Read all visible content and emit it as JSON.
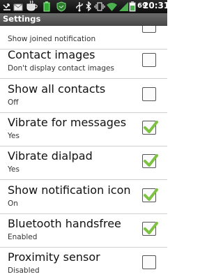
{
  "status_bar": {
    "battery_level": "69",
    "time": "20:31",
    "icons": [
      "missed-call-icon",
      "mail-icon",
      "coffee-cup-icon",
      "battery-app-icon",
      "shield-icon",
      "usb-icon",
      "bluetooth-icon",
      "vibrate-icon",
      "wifi-icon",
      "signal-icon",
      "battery-icon"
    ]
  },
  "title_bar": {
    "title": "Settings"
  },
  "settings": [
    {
      "title": "",
      "subtitle": "Show joined notification",
      "checked": false,
      "partial": true
    },
    {
      "title": "Contact images",
      "subtitle": "Don't display contact images",
      "checked": false
    },
    {
      "title": "Show all contacts",
      "subtitle": "Off",
      "checked": false
    },
    {
      "title": "Vibrate for messages",
      "subtitle": "Yes",
      "checked": true
    },
    {
      "title": "Vibrate dialpad",
      "subtitle": "Yes",
      "checked": true
    },
    {
      "title": "Show notification icon",
      "subtitle": "On",
      "checked": true
    },
    {
      "title": "Bluetooth handsfree",
      "subtitle": "Enabled",
      "checked": true
    },
    {
      "title": "Proximity sensor",
      "subtitle": "Disabled",
      "checked": false
    }
  ],
  "colors": {
    "check": "#7dc242",
    "divider": "#cfcfcf",
    "title_bar": "#555555"
  }
}
